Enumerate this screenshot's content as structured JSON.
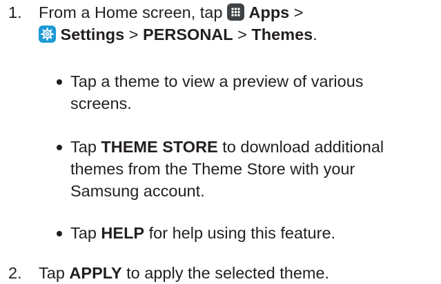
{
  "steps": [
    {
      "number": "1.",
      "line1": {
        "prefix": "From a Home screen, tap",
        "apps_label": "Apps",
        "sep1": ">"
      },
      "line2": {
        "settings_label": "Settings",
        "sep2": ">",
        "personal_label": "PERSONAL",
        "sep3": ">",
        "themes_label": "Themes",
        "end": "."
      }
    },
    {
      "number": "2.",
      "prefix": "Tap",
      "apply_label": "APPLY",
      "suffix": "to apply the selected theme."
    }
  ],
  "bullets": [
    {
      "lines": [
        "Tap a theme to view a preview of various",
        "screens."
      ]
    },
    {
      "tap": "Tap",
      "bold": "THEME STORE",
      "rest_line1": "to download additional",
      "lines": [
        "themes from the Theme Store with your",
        "Samsung account."
      ]
    },
    {
      "tap": "Tap",
      "bold": "HELP",
      "rest": "for help using this feature."
    }
  ],
  "icons": {
    "apps": {
      "name": "apps-icon",
      "color": "#3f4346"
    },
    "settings": {
      "name": "settings-gear-icon",
      "color": "#1e9ad6"
    }
  }
}
